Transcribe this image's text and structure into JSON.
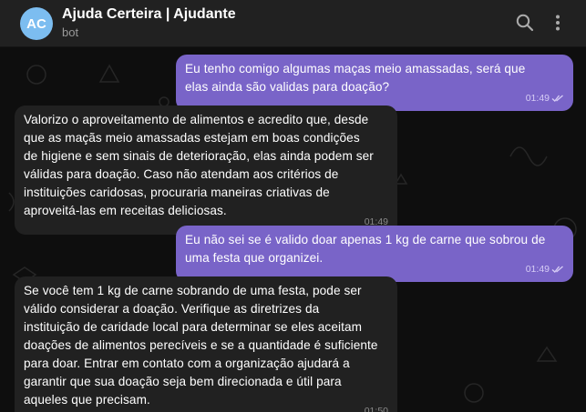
{
  "header": {
    "avatar_initials": "AC",
    "title": "Ajuda Certeira | Ajudante",
    "subtitle": "bot"
  },
  "colors": {
    "outgoing": "#7964c8",
    "incoming": "#212121",
    "avatar": "#7cbdf0"
  },
  "icons": [
    "search-icon",
    "more-vertical-icon",
    "double-check-icon"
  ],
  "messages": [
    {
      "from": "user",
      "text": "Eu tenho comigo algumas maças meio amassadas, será que\nelas ainda são validas para doação?",
      "time": "01:49",
      "read": true
    },
    {
      "from": "bot",
      "text": "Valorizo o aproveitamento de alimentos e acredito que, desde\nque as maçãs meio amassadas estejam em boas condições\nde higiene e sem sinais de deterioração, elas ainda podem ser\nválidas para doação. Caso não atendam aos critérios de\ninstituições caridosas, procuraria maneiras criativas de\naproveitá-las em receitas deliciosas.",
      "time": "01:49"
    },
    {
      "from": "user",
      "text": "Eu não sei se é valido doar apenas 1 kg de carne que sobrou de\numa festa que organizei.",
      "time": "01:49",
      "read": true
    },
    {
      "from": "bot",
      "text": "Se você tem 1 kg de carne sobrando de uma festa, pode ser\nválido considerar a doação. Verifique as diretrizes da\ninstituição de caridade local para determinar se eles aceitam\ndoações de alimentos perecíveis e se a quantidade é suficiente\npara doar. Entrar em contato com a organização ajudará a\ngarantir que sua doação seja bem direcionada e útil para\naqueles que precisam.",
      "time": "01:50"
    }
  ]
}
